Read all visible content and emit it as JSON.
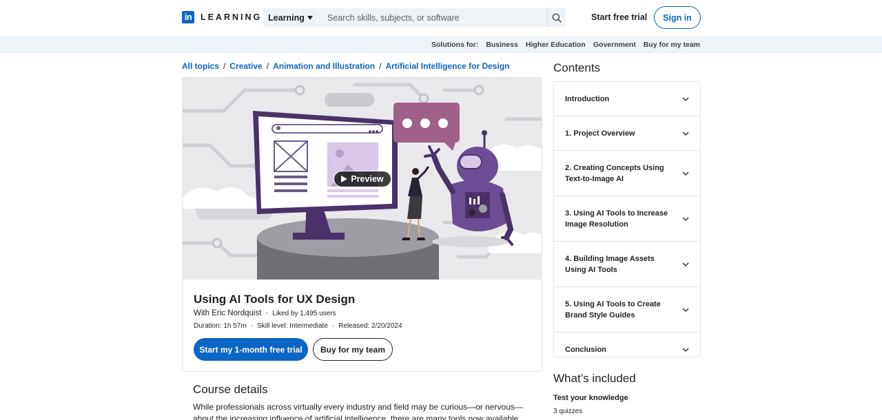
{
  "header": {
    "logo_letters": "in",
    "logo_text": "LEARNING",
    "search_category": "Learning",
    "search_placeholder": "Search skills, subjects, or software",
    "start_free_trial": "Start free trial",
    "sign_in": "Sign in"
  },
  "solutions": {
    "label": "Solutions for:",
    "items": [
      "Business",
      "Higher Education",
      "Government",
      "Buy for my team"
    ]
  },
  "breadcrumb": [
    "All topics",
    "Creative",
    "Animation and Illustration",
    "Artificial Intelligence for Design"
  ],
  "course": {
    "preview_label": "Preview",
    "title": "Using AI Tools for UX Design",
    "author": "With Eric Nordquist",
    "liked": "Liked by 1,495 users",
    "duration": "Duration: 1h 57m",
    "skill_level": "Skill level: Intermediate",
    "released": "Released: 2/20/2024",
    "primary_cta": "Start my 1-month free trial",
    "secondary_cta": "Buy for my team"
  },
  "details": {
    "heading": "Course details",
    "body": "While professionals across virtually every industry and field may be curious—or nervous—about the increasing influence of artificial intelligence, there are many tools now available that can help you"
  },
  "contents": {
    "heading": "Contents",
    "sections": [
      "Introduction",
      "1. Project Overview",
      "2. Creating Concepts Using Text-to-Image AI",
      "3. Using AI Tools to Increase Image Resolution",
      "4. Building Image Assets Using AI Tools",
      "5. Using AI Tools to Create Brand Style Guides",
      "Conclusion"
    ]
  },
  "included": {
    "heading": "What’s included",
    "item_title": "Test your knowledge",
    "item_value": "3 quizzes"
  },
  "colors": {
    "brand": "#0a66c2",
    "bar_bg": "#eef3f8",
    "illustration_purple": "#4a3169"
  }
}
